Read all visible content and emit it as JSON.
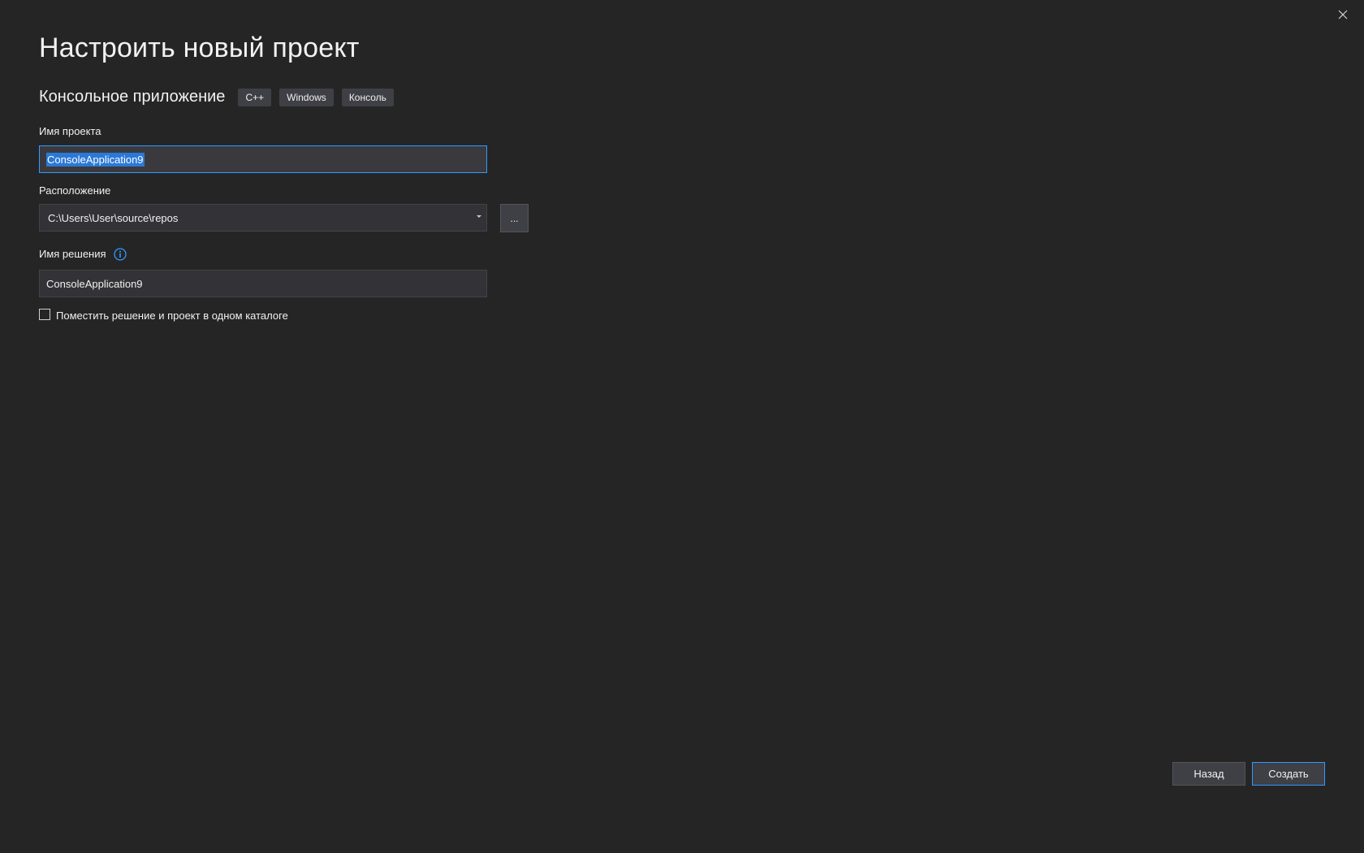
{
  "dialog": {
    "title": "Настроить новый проект",
    "close_icon": "close-icon"
  },
  "template": {
    "name": "Консольное приложение",
    "tags": [
      "C++",
      "Windows",
      "Консоль"
    ]
  },
  "project_name": {
    "label": "Имя проекта",
    "value": "ConsoleApplication9"
  },
  "location": {
    "label": "Расположение",
    "value": "C:\\Users\\User\\source\\repos",
    "browse_label": "..."
  },
  "solution_name": {
    "label": "Имя решения",
    "value": "ConsoleApplication9",
    "info_icon": "info-icon"
  },
  "same_directory": {
    "label": "Поместить решение и проект в одном каталоге",
    "checked": false
  },
  "footer": {
    "back_label": "Назад",
    "create_label": "Создать"
  },
  "colors": {
    "background": "#252526",
    "accent": "#3399ff",
    "selection": "#2b79d7"
  }
}
